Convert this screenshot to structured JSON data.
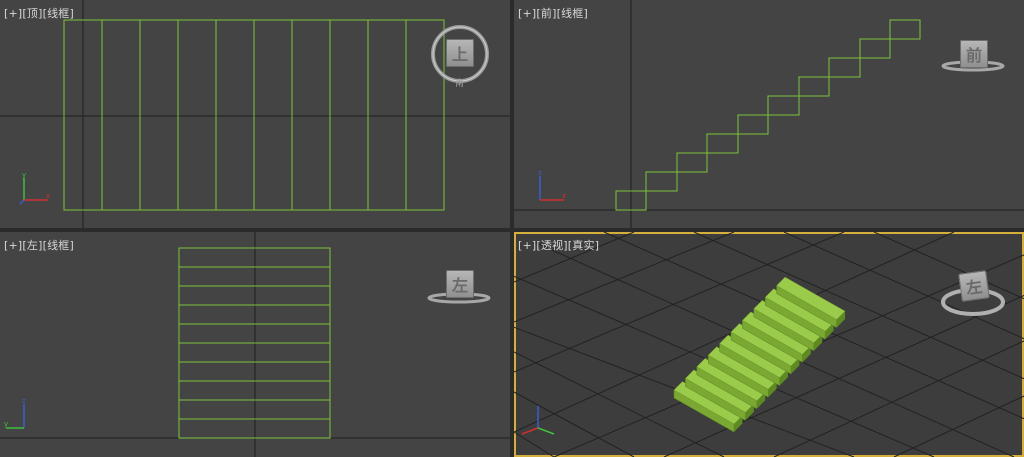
{
  "viewports": {
    "top": {
      "plus": "[+]",
      "view": "[顶]",
      "shading": "[线框]",
      "cube_face": "上",
      "ring_letter": "南"
    },
    "front": {
      "plus": "[+]",
      "view": "[前]",
      "shading": "[线框]",
      "cube_face": "前"
    },
    "left": {
      "plus": "[+]",
      "view": "[左]",
      "shading": "[线框]",
      "cube_face": "左"
    },
    "perspective": {
      "plus": "[+]",
      "view": "[透视]",
      "shading": "[真实]",
      "cube_face": "左",
      "active": true
    }
  },
  "colors": {
    "background": "#444444",
    "wire": "#7bc43a",
    "stair_top": "#9acb4a",
    "stair_front": "#7aa832",
    "stair_side": "#5e8a22",
    "active_border": "#d6ae3b",
    "grid_dark": "#1e1e1e",
    "grid_light": "#555555"
  },
  "icons": [
    "viewcube-icon",
    "compass-ring-icon",
    "axis-tripod-icon"
  ]
}
